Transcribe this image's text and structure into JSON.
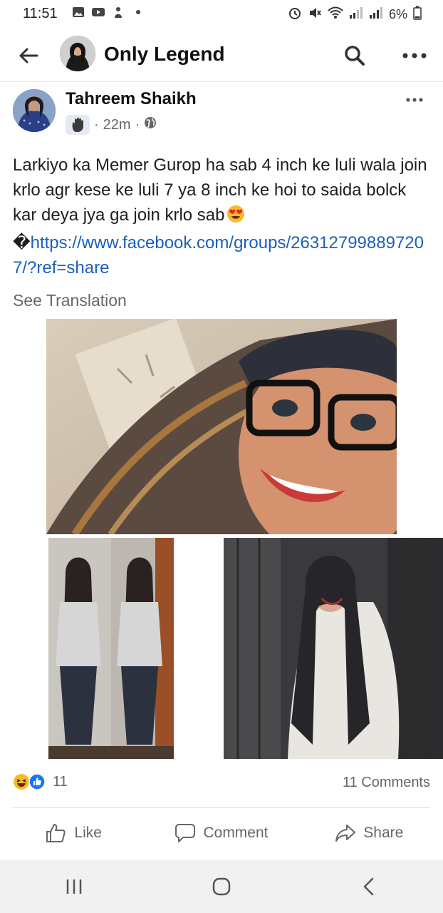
{
  "status_bar": {
    "time": "11:51",
    "battery": "6%"
  },
  "app_bar": {
    "title": "Only Legend"
  },
  "post": {
    "author": "Tahreem Shaikh",
    "time": "22m",
    "separator": "·",
    "text": "Larkiyo ka Memer Gurop ha sab  4 inch ke luli wala join krlo agr kese ke luli 7 ya 8 inch ke hoi to saida bolck   kar deya jya ga   join krlo sab",
    "link_prefix": "�",
    "link": "https://www.facebook.com/groups/263127998897207/?ref=share",
    "see_translation": "See Translation"
  },
  "engagement": {
    "reaction_count": "11",
    "comments": "11 Comments"
  },
  "actions": {
    "like": "Like",
    "comment": "Comment",
    "share": "Share"
  },
  "colors": {
    "link": "#1c5fbd",
    "like_blue": "#1877f2",
    "haha_yellow": "#f7b928",
    "muted": "#65676b"
  },
  "icons": [
    "back-arrow-icon",
    "search-icon",
    "more-icon",
    "wave-badge-icon",
    "globe-icon",
    "haha-reaction-icon",
    "like-reaction-icon",
    "like-icon",
    "comment-icon",
    "share-icon",
    "recents-icon",
    "home-icon",
    "nav-back-icon"
  ]
}
